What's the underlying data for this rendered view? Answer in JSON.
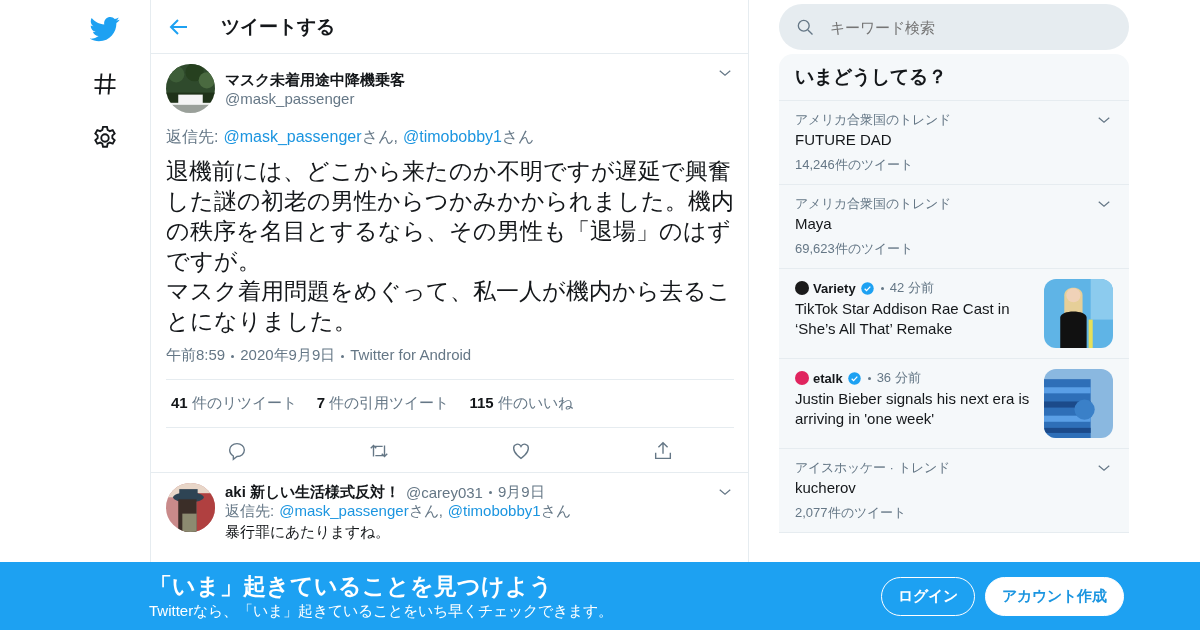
{
  "header": {
    "title": "ツイートする"
  },
  "tweet": {
    "name": "マスク未着用途中降機乗客",
    "handle": "@mask_passenger",
    "reply_to": {
      "label": "返信先:",
      "mentions": [
        {
          "handle": "@mask_passenger",
          "suffix": "さん,"
        },
        {
          "handle": "@timobobby1",
          "suffix": "さん"
        }
      ]
    },
    "paragraphs": [
      "退機前には、どこから来たのか不明ですが遅延で興奮した謎の初老の男性からつかみかかられました。機内の秩序を名目とするなら、その男性も「退場」のはずですが。",
      "マスク着用問題をめぐって、私一人が機内から去ることになりました。"
    ],
    "meta": [
      "午前8:59",
      "2020年9月9日",
      "Twitter for Android"
    ],
    "stats": [
      {
        "count": "41",
        "label": "件のリツイート"
      },
      {
        "count": "7",
        "label": "件の引用ツイート"
      },
      {
        "count": "115",
        "label": "件のいいね"
      }
    ]
  },
  "reply": {
    "name": "aki 新しい生活様式反対！",
    "handle": "@carey031",
    "date": "9月9日",
    "reply_to": {
      "label": "返信先:",
      "mentions": [
        {
          "handle": "@mask_passenger",
          "suffix": "さん,"
        },
        {
          "handle": "@timobobby1",
          "suffix": "さん"
        }
      ]
    },
    "text": "暴行罪にあたりますね。"
  },
  "search": {
    "placeholder": "キーワード検索"
  },
  "trends": {
    "title": "いまどうしてる？",
    "items": [
      {
        "kind": "trend",
        "context": "アメリカ合衆国のトレンド",
        "topic": "FUTURE DAD",
        "count": "14,246件のツイート"
      },
      {
        "kind": "trend",
        "context": "アメリカ合衆国のトレンド",
        "topic": "Maya",
        "count": "69,623件のツイート"
      },
      {
        "kind": "news",
        "source": "Variety",
        "time": "42 分前",
        "headline": "TikTok Star Addison Rae Cast in ‘She’s All That’ Remake",
        "color": "#1a1a1a"
      },
      {
        "kind": "news",
        "source": "etalk",
        "time": "36 分前",
        "headline": "Justin Bieber signals his next era is arriving in 'one week'",
        "color": "#e0245e"
      },
      {
        "kind": "trend",
        "context": "アイスホッケー · トレンド",
        "topic": "kucherov",
        "count": "2,077件のツイート"
      }
    ]
  },
  "banner": {
    "title": "「いま」起きていることを見つけよう",
    "subtitle": "Twitterなら、「いま」起きていることをいち早くチェックできます。",
    "login": "ログイン",
    "signup": "アカウント作成"
  }
}
